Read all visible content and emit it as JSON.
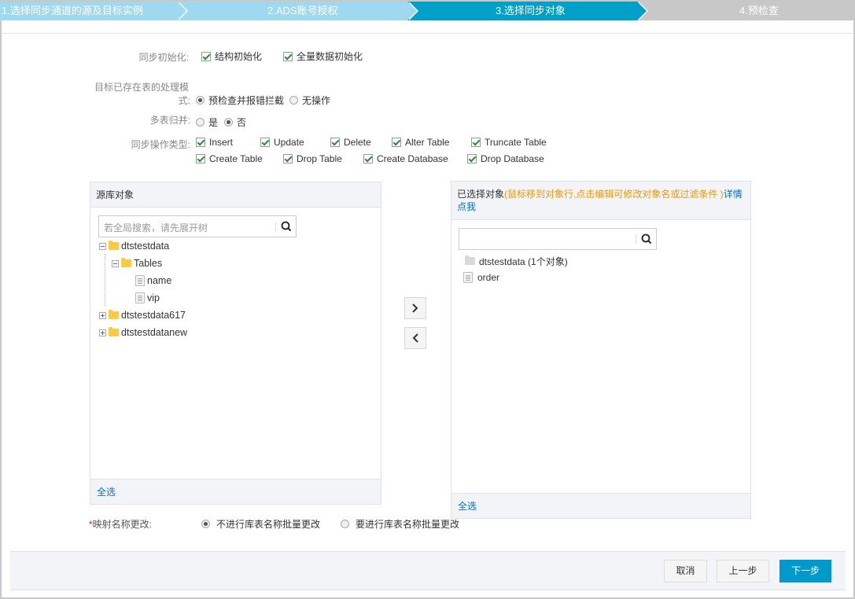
{
  "steps": [
    {
      "label": "1.选择同步通道的源及目标实例",
      "state": "done"
    },
    {
      "label": "2.ADS账号授权",
      "state": "done"
    },
    {
      "label": "3.选择同步对象",
      "state": "active"
    },
    {
      "label": "4.预检查",
      "state": "pending"
    }
  ],
  "form": {
    "sync_init": {
      "label": "同步初始化:",
      "options": [
        {
          "label": "结构初始化",
          "checked": true
        },
        {
          "label": "全量数据初始化",
          "checked": true
        }
      ]
    },
    "existing_table_mode": {
      "label_line1": "目标已存在表的处理模",
      "label_line2": "式:",
      "options": [
        {
          "label": "预检查并报错拦截",
          "selected": true
        },
        {
          "label": "无操作",
          "selected": false
        }
      ]
    },
    "multi_table_merge": {
      "label": "多表归并:",
      "options": [
        {
          "label": "是",
          "selected": false
        },
        {
          "label": "否",
          "selected": true
        }
      ]
    },
    "sync_op_types": {
      "label": "同步操作类型:",
      "options": [
        {
          "label": "Insert",
          "checked": true
        },
        {
          "label": "Update",
          "checked": true
        },
        {
          "label": "Delete",
          "checked": true
        },
        {
          "label": "Alter Table",
          "checked": true
        },
        {
          "label": "Truncate Table",
          "checked": true
        },
        {
          "label": "Create Table",
          "checked": true
        },
        {
          "label": "Drop Table",
          "checked": true
        },
        {
          "label": "Create Database",
          "checked": true
        },
        {
          "label": "Drop Database",
          "checked": true
        }
      ]
    }
  },
  "source_panel": {
    "title": "源库对象",
    "search_placeholder": "若全局搜索，请先展开树",
    "tree": [
      {
        "label": "dtstestdata",
        "type": "database",
        "expanded": true
      },
      {
        "label": "Tables",
        "type": "folder",
        "expanded": true
      },
      {
        "label": "name",
        "type": "table"
      },
      {
        "label": "vip",
        "type": "table"
      },
      {
        "label": "dtstestdata617",
        "type": "database",
        "expanded": false
      },
      {
        "label": "dtstestdatanew",
        "type": "database",
        "expanded": false
      }
    ],
    "select_all": "全选"
  },
  "move_buttons": {
    "right_icon": "chevron-right",
    "left_icon": "chevron-left"
  },
  "selected_panel": {
    "title": "已选择对象",
    "hint": "(鼠标移到对象行,点击编辑可修改对象名或过滤条件 )",
    "details_link": "详情点我",
    "search_placeholder": "",
    "tree": [
      {
        "label": "dtstestdata (1个对象)",
        "type": "database"
      },
      {
        "label": "order",
        "type": "table"
      }
    ],
    "select_all": "全选"
  },
  "mapping": {
    "required_mark": "*",
    "label": "映射名称更改:",
    "options": [
      {
        "label": "不进行库表名称批量更改",
        "selected": true
      },
      {
        "label": "要进行库表名称批量更改",
        "selected": false
      }
    ]
  },
  "footer": {
    "cancel": "取消",
    "prev": "上一步",
    "next": "下一步"
  },
  "colors": {
    "step_done": "#9ed9f0",
    "step_active": "#00a0c8",
    "step_pending": "#c8c8c8",
    "primary": "#0099cc",
    "link": "#0070cc",
    "hint": "#f39800"
  }
}
